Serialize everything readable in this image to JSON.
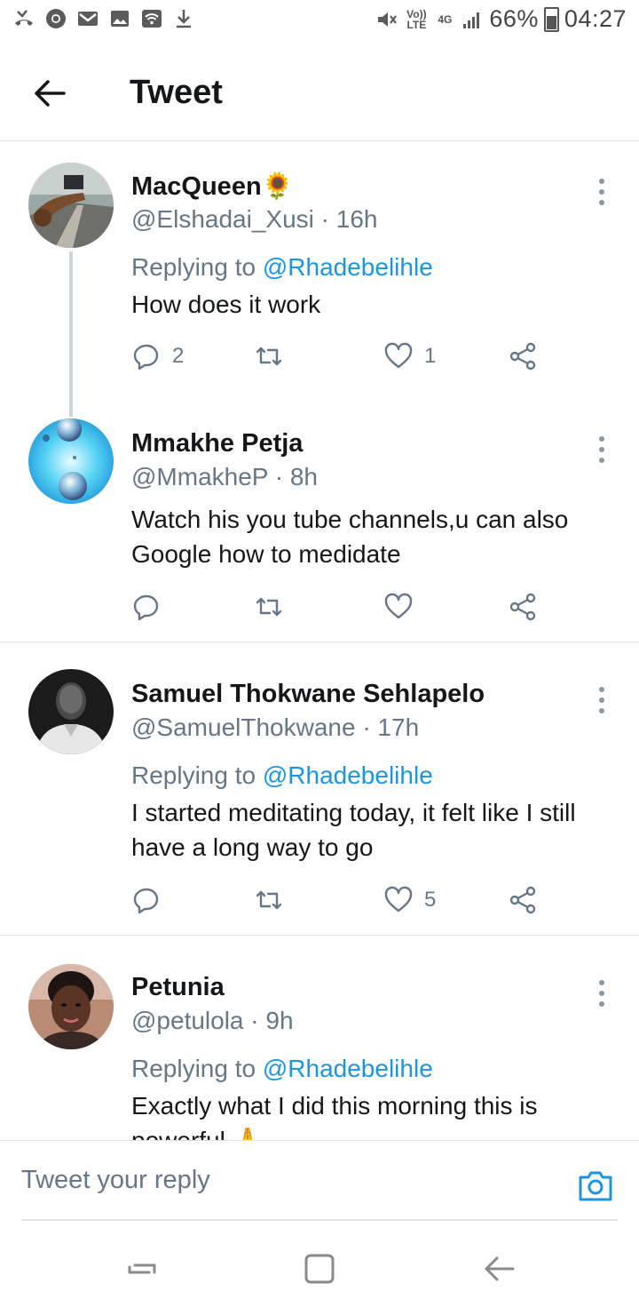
{
  "status_bar": {
    "left_icons": [
      "missed-call-icon",
      "chrome-icon",
      "gmail-icon",
      "gallery-icon",
      "wifi-icon",
      "download-icon"
    ],
    "volte_label": "Vo)) LTE",
    "network_label": "4G",
    "battery": "66%",
    "time": "04:27"
  },
  "header": {
    "title": "Tweet"
  },
  "tweets": [
    {
      "name": "MacQueen🌻",
      "handle": "@Elshadai_Xusi · 16h",
      "replying_prefix": "Replying to ",
      "replying_to": "@Rhadebelihle",
      "text": "How does it work",
      "replies": "2",
      "retweets": "",
      "likes": "1"
    },
    {
      "name": "Mmakhe Petja",
      "handle": "@MmakheP · 8h",
      "replying_prefix": "",
      "replying_to": "",
      "text": "Watch his you tube channels,u can also Google how to medidate",
      "replies": "",
      "retweets": "",
      "likes": ""
    },
    {
      "name": "Samuel Thokwane Sehlapelo",
      "handle": "@SamuelThokwane · 17h",
      "replying_prefix": "Replying to ",
      "replying_to": "@Rhadebelihle",
      "text": "I started meditating today, it felt like I still have a long way to go",
      "replies": "",
      "retweets": "",
      "likes": "5"
    },
    {
      "name": "Petunia",
      "handle": "@petulola · 9h",
      "replying_prefix": "Replying to ",
      "replying_to": "@Rhadebelihle",
      "text": "Exactly what I did this morning this is powerful 🙏",
      "replies": "",
      "retweets": "",
      "likes": ""
    }
  ],
  "reply_bar": {
    "placeholder": "Tweet your reply"
  },
  "colors": {
    "accent": "#1b95e0",
    "secondary_text": "#657786",
    "primary_text": "#14171a",
    "divider": "#dfe3e6"
  }
}
